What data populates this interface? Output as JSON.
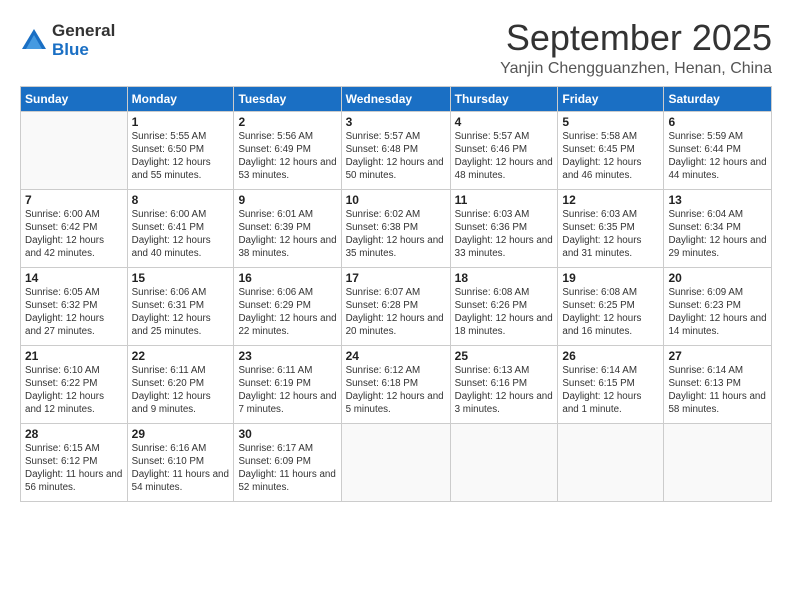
{
  "header": {
    "logo_general": "General",
    "logo_blue": "Blue",
    "month_title": "September 2025",
    "location": "Yanjin Chengguanzhen, Henan, China"
  },
  "days_of_week": [
    "Sunday",
    "Monday",
    "Tuesday",
    "Wednesday",
    "Thursday",
    "Friday",
    "Saturday"
  ],
  "weeks": [
    [
      {
        "day": "",
        "sunrise": "",
        "sunset": "",
        "daylight": ""
      },
      {
        "day": "1",
        "sunrise": "Sunrise: 5:55 AM",
        "sunset": "Sunset: 6:50 PM",
        "daylight": "Daylight: 12 hours and 55 minutes."
      },
      {
        "day": "2",
        "sunrise": "Sunrise: 5:56 AM",
        "sunset": "Sunset: 6:49 PM",
        "daylight": "Daylight: 12 hours and 53 minutes."
      },
      {
        "day": "3",
        "sunrise": "Sunrise: 5:57 AM",
        "sunset": "Sunset: 6:48 PM",
        "daylight": "Daylight: 12 hours and 50 minutes."
      },
      {
        "day": "4",
        "sunrise": "Sunrise: 5:57 AM",
        "sunset": "Sunset: 6:46 PM",
        "daylight": "Daylight: 12 hours and 48 minutes."
      },
      {
        "day": "5",
        "sunrise": "Sunrise: 5:58 AM",
        "sunset": "Sunset: 6:45 PM",
        "daylight": "Daylight: 12 hours and 46 minutes."
      },
      {
        "day": "6",
        "sunrise": "Sunrise: 5:59 AM",
        "sunset": "Sunset: 6:44 PM",
        "daylight": "Daylight: 12 hours and 44 minutes."
      }
    ],
    [
      {
        "day": "7",
        "sunrise": "Sunrise: 6:00 AM",
        "sunset": "Sunset: 6:42 PM",
        "daylight": "Daylight: 12 hours and 42 minutes."
      },
      {
        "day": "8",
        "sunrise": "Sunrise: 6:00 AM",
        "sunset": "Sunset: 6:41 PM",
        "daylight": "Daylight: 12 hours and 40 minutes."
      },
      {
        "day": "9",
        "sunrise": "Sunrise: 6:01 AM",
        "sunset": "Sunset: 6:39 PM",
        "daylight": "Daylight: 12 hours and 38 minutes."
      },
      {
        "day": "10",
        "sunrise": "Sunrise: 6:02 AM",
        "sunset": "Sunset: 6:38 PM",
        "daylight": "Daylight: 12 hours and 35 minutes."
      },
      {
        "day": "11",
        "sunrise": "Sunrise: 6:03 AM",
        "sunset": "Sunset: 6:36 PM",
        "daylight": "Daylight: 12 hours and 33 minutes."
      },
      {
        "day": "12",
        "sunrise": "Sunrise: 6:03 AM",
        "sunset": "Sunset: 6:35 PM",
        "daylight": "Daylight: 12 hours and 31 minutes."
      },
      {
        "day": "13",
        "sunrise": "Sunrise: 6:04 AM",
        "sunset": "Sunset: 6:34 PM",
        "daylight": "Daylight: 12 hours and 29 minutes."
      }
    ],
    [
      {
        "day": "14",
        "sunrise": "Sunrise: 6:05 AM",
        "sunset": "Sunset: 6:32 PM",
        "daylight": "Daylight: 12 hours and 27 minutes."
      },
      {
        "day": "15",
        "sunrise": "Sunrise: 6:06 AM",
        "sunset": "Sunset: 6:31 PM",
        "daylight": "Daylight: 12 hours and 25 minutes."
      },
      {
        "day": "16",
        "sunrise": "Sunrise: 6:06 AM",
        "sunset": "Sunset: 6:29 PM",
        "daylight": "Daylight: 12 hours and 22 minutes."
      },
      {
        "day": "17",
        "sunrise": "Sunrise: 6:07 AM",
        "sunset": "Sunset: 6:28 PM",
        "daylight": "Daylight: 12 hours and 20 minutes."
      },
      {
        "day": "18",
        "sunrise": "Sunrise: 6:08 AM",
        "sunset": "Sunset: 6:26 PM",
        "daylight": "Daylight: 12 hours and 18 minutes."
      },
      {
        "day": "19",
        "sunrise": "Sunrise: 6:08 AM",
        "sunset": "Sunset: 6:25 PM",
        "daylight": "Daylight: 12 hours and 16 minutes."
      },
      {
        "day": "20",
        "sunrise": "Sunrise: 6:09 AM",
        "sunset": "Sunset: 6:23 PM",
        "daylight": "Daylight: 12 hours and 14 minutes."
      }
    ],
    [
      {
        "day": "21",
        "sunrise": "Sunrise: 6:10 AM",
        "sunset": "Sunset: 6:22 PM",
        "daylight": "Daylight: 12 hours and 12 minutes."
      },
      {
        "day": "22",
        "sunrise": "Sunrise: 6:11 AM",
        "sunset": "Sunset: 6:20 PM",
        "daylight": "Daylight: 12 hours and 9 minutes."
      },
      {
        "day": "23",
        "sunrise": "Sunrise: 6:11 AM",
        "sunset": "Sunset: 6:19 PM",
        "daylight": "Daylight: 12 hours and 7 minutes."
      },
      {
        "day": "24",
        "sunrise": "Sunrise: 6:12 AM",
        "sunset": "Sunset: 6:18 PM",
        "daylight": "Daylight: 12 hours and 5 minutes."
      },
      {
        "day": "25",
        "sunrise": "Sunrise: 6:13 AM",
        "sunset": "Sunset: 6:16 PM",
        "daylight": "Daylight: 12 hours and 3 minutes."
      },
      {
        "day": "26",
        "sunrise": "Sunrise: 6:14 AM",
        "sunset": "Sunset: 6:15 PM",
        "daylight": "Daylight: 12 hours and 1 minute."
      },
      {
        "day": "27",
        "sunrise": "Sunrise: 6:14 AM",
        "sunset": "Sunset: 6:13 PM",
        "daylight": "Daylight: 11 hours and 58 minutes."
      }
    ],
    [
      {
        "day": "28",
        "sunrise": "Sunrise: 6:15 AM",
        "sunset": "Sunset: 6:12 PM",
        "daylight": "Daylight: 11 hours and 56 minutes."
      },
      {
        "day": "29",
        "sunrise": "Sunrise: 6:16 AM",
        "sunset": "Sunset: 6:10 PM",
        "daylight": "Daylight: 11 hours and 54 minutes."
      },
      {
        "day": "30",
        "sunrise": "Sunrise: 6:17 AM",
        "sunset": "Sunset: 6:09 PM",
        "daylight": "Daylight: 11 hours and 52 minutes."
      },
      {
        "day": "",
        "sunrise": "",
        "sunset": "",
        "daylight": ""
      },
      {
        "day": "",
        "sunrise": "",
        "sunset": "",
        "daylight": ""
      },
      {
        "day": "",
        "sunrise": "",
        "sunset": "",
        "daylight": ""
      },
      {
        "day": "",
        "sunrise": "",
        "sunset": "",
        "daylight": ""
      }
    ]
  ]
}
